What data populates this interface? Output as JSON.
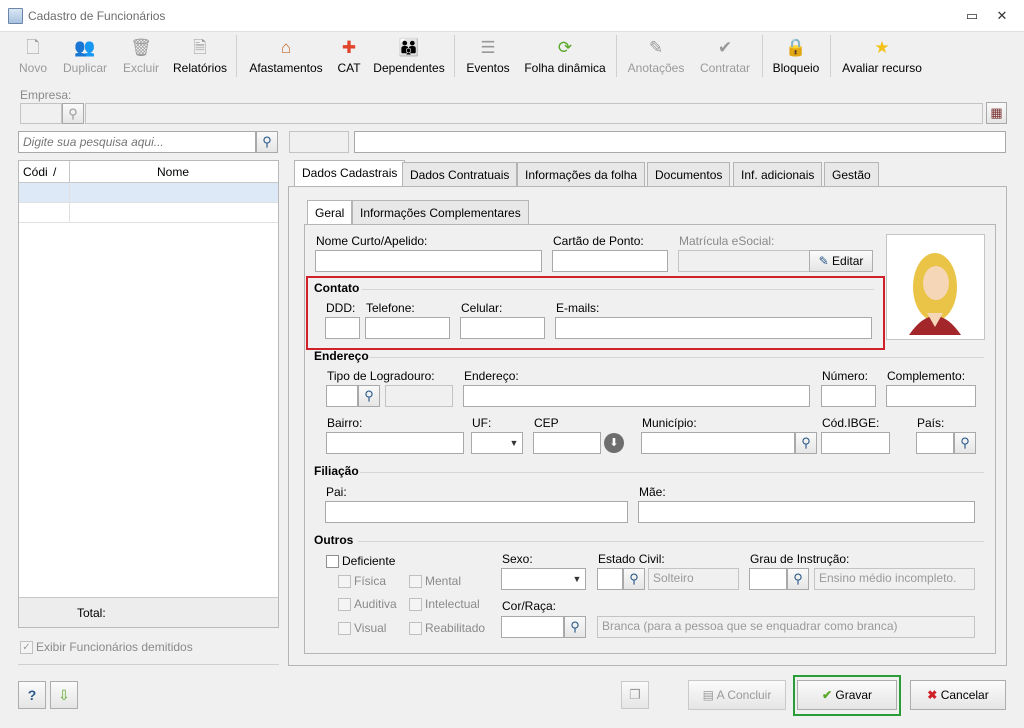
{
  "window": {
    "title": "Cadastro de Funcionários"
  },
  "toolbar": [
    {
      "label": "Novo",
      "icon": "new-doc-icon",
      "enabled": false
    },
    {
      "label": "Duplicar",
      "icon": "duplicate-icon",
      "enabled": false
    },
    {
      "label": "Excluir",
      "icon": "trash-icon",
      "enabled": false
    },
    {
      "label": "Relatórios",
      "icon": "report-icon",
      "enabled": true
    },
    {
      "label": "Afastamentos",
      "icon": "house-arrow-icon",
      "enabled": true
    },
    {
      "label": "CAT",
      "icon": "medical-cross-icon",
      "enabled": true
    },
    {
      "label": "Dependentes",
      "icon": "people-icon",
      "enabled": true
    },
    {
      "label": "Eventos",
      "icon": "list-icon",
      "enabled": true
    },
    {
      "label": "Folha dinâmica",
      "icon": "dynamic-sheet-icon",
      "enabled": true
    },
    {
      "label": "Anotações",
      "icon": "notes-icon",
      "enabled": false
    },
    {
      "label": "Contratar",
      "icon": "hire-icon",
      "enabled": false
    },
    {
      "label": "Bloqueio",
      "icon": "lock-icon",
      "enabled": true
    },
    {
      "label": "Avaliar recurso",
      "icon": "star-icon",
      "enabled": true
    }
  ],
  "empresa": {
    "label": "Empresa:"
  },
  "search": {
    "placeholder": "Digite sua pesquisa aqui..."
  },
  "grid": {
    "col_code": "Códi",
    "col_sort": "/",
    "col_name": "Nome",
    "total_label": "Total:"
  },
  "show_dismissed": {
    "label": "Exibir Funcionários demitidos",
    "checked": true
  },
  "tabs": [
    "Dados Cadastrais",
    "Dados Contratuais",
    "Informações da folha",
    "Documentos",
    "Inf. adicionais",
    "Gestão"
  ],
  "subtabs": [
    "Geral",
    "Informações Complementares"
  ],
  "form": {
    "nome_curto": "Nome Curto/Apelido:",
    "cartao_ponto": "Cartão de Ponto:",
    "matricula": "Matrícula eSocial:",
    "editar": "Editar",
    "contato": {
      "title": "Contato",
      "ddd": "DDD:",
      "telefone": "Telefone:",
      "celular": "Celular:",
      "emails": "E-mails:"
    },
    "endereco": {
      "title": "Endereço",
      "tipo": "Tipo de Logradouro:",
      "endereco": "Endereço:",
      "numero": "Número:",
      "complemento": "Complemento:",
      "bairro": "Bairro:",
      "uf": "UF:",
      "cep": "CEP",
      "municipio": "Município:",
      "ibge": "Cód.IBGE:",
      "pais": "País:"
    },
    "filiacao": {
      "title": "Filiação",
      "pai": "Pai:",
      "mae": "Mãe:"
    },
    "outros": {
      "title": "Outros",
      "deficiente": "Deficiente",
      "fisica": "Física",
      "mental": "Mental",
      "auditiva": "Auditiva",
      "intelectual": "Intelectual",
      "visual": "Visual",
      "reabilitado": "Reabilitado",
      "sexo": "Sexo:",
      "estado_civil": "Estado Civil:",
      "estado_civil_value": "Solteiro",
      "grau": "Grau de Instrução:",
      "grau_value": "Ensino médio incompleto.",
      "cor": "Cor/Raça:",
      "cor_value": "Branca (para a pessoa que se enquadrar como branca)"
    }
  },
  "buttons": {
    "concluir": "A Concluir",
    "gravar": "Gravar",
    "cancelar": "Cancelar"
  },
  "colors": {
    "highlight_red": "#d0202a",
    "highlight_green": "#2a9d3a"
  }
}
